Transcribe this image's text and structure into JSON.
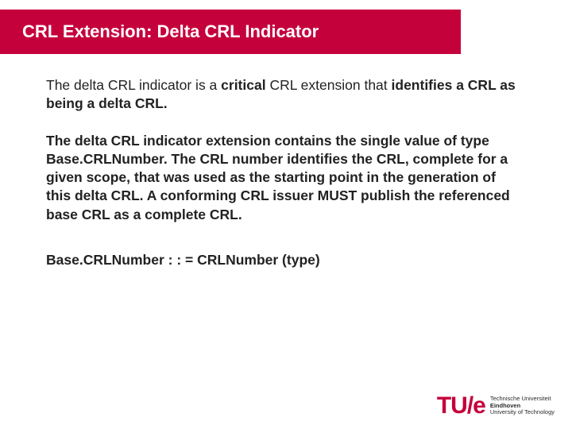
{
  "title": "CRL Extension: Delta CRL Indicator",
  "p1": {
    "a": "The delta CRL indicator is a ",
    "b": "critical",
    "c": " CRL extension that ",
    "d": "identifies a CRL as being a delta CRL."
  },
  "p2": {
    "a": "The delta CRL indicator extension contains the single value of type Base.CRLNumber. ",
    "b": "The CRL number identifies the CRL, complete for a given scope, that was used as the starting point in the generation of this delta CRL.",
    "c": " A conforming CRL issuer MUST publish the referenced base CRL as a complete CRL."
  },
  "p3": "Base.CRLNumber : : = CRLNumber (type)",
  "logo": {
    "mark": "TU/e",
    "line1": "Technische Universiteit",
    "line2": "Eindhoven",
    "line3": "University of Technology"
  }
}
